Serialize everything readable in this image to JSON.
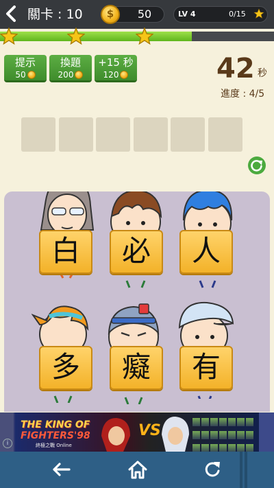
{
  "header": {
    "level_label": "關卡 : 10",
    "coins": "50",
    "player_level": "LV 4",
    "xp": "0/15"
  },
  "progress": {
    "fraction": 0.7
  },
  "help_buttons": [
    {
      "label": "提示",
      "cost": "50"
    },
    {
      "label": "換題",
      "cost": "200"
    },
    {
      "label": "+15 秒",
      "cost": "120"
    }
  ],
  "timer": {
    "value": "42",
    "unit": "秒",
    "progress": "進度 : 4/5"
  },
  "answer_slots": [
    "",
    "",
    "",
    "",
    "",
    ""
  ],
  "characters": [
    {
      "char": "白",
      "icon": "old-man-glasses-icon"
    },
    {
      "char": "必",
      "icon": "brown-hair-boy-icon"
    },
    {
      "char": "人",
      "icon": "blue-hair-boy-icon"
    },
    {
      "char": "多",
      "icon": "orange-hair-boy-icon"
    },
    {
      "char": "癡",
      "icon": "headband-man-icon"
    },
    {
      "char": "有",
      "icon": "cap-boy-icon"
    }
  ],
  "ad": {
    "title_line1": "THE KING OF",
    "title_line2": "FIGHTERS'98",
    "subtitle": "終極之戰 Online",
    "vs": "VS",
    "info_icon": "info-icon"
  },
  "nav": {
    "back_icon": "arrow-left-icon",
    "home_icon": "home-icon",
    "refresh_icon": "refresh-icon"
  },
  "colors": {
    "topbar": "#36393d",
    "progress_fill": "#6cc027",
    "help_button": "#4a9a35",
    "timer_text": "#5a3a1a",
    "card": "#f3b229",
    "play_area": "#c9bfd1",
    "nav": "#2e5f86"
  }
}
